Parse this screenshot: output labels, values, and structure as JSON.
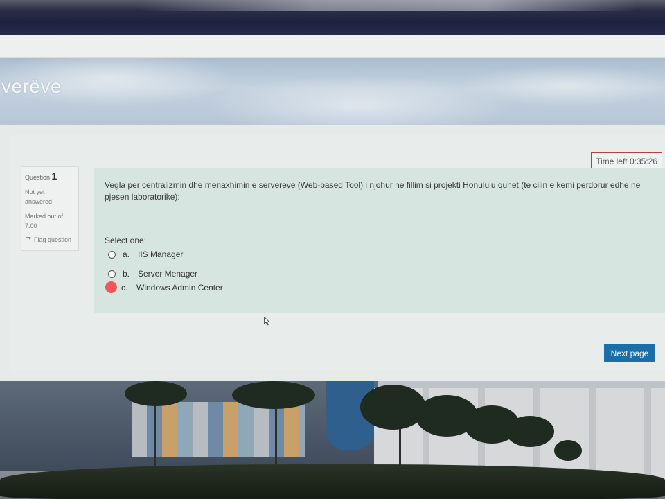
{
  "page": {
    "title_fragment": "verëve"
  },
  "quiz": {
    "timer_label": "Time left 0:35:26",
    "question": {
      "label": "Question",
      "number": "1",
      "status_line1": "Not yet",
      "status_line2": "answered",
      "marked_line1": "Marked out of",
      "marked_line2": "7.00",
      "flag_label": "Flag question",
      "text": "Vegla per centralizmin dhe menaxhimin e servereve (Web-based Tool) i njohur ne fillim si projekti Honululu quhet (te cilin e kemi perdorur edhe ne pjesen laboratorike):",
      "prompt": "Select one:",
      "options": [
        {
          "letter": "a.",
          "label": "IIS Manager",
          "selected": false
        },
        {
          "letter": "b.",
          "label": "Server Menager",
          "selected": false
        },
        {
          "letter": "c.",
          "label": "Windows Admin Center",
          "selected": true
        }
      ]
    },
    "next_button": "Next page"
  },
  "colors": {
    "accent": "#1b6fa8",
    "timer_border": "#b34343",
    "selected_option": "#f0585e",
    "question_background": "#d7e5e1"
  },
  "icons": [
    "flag-icon",
    "mouse-cursor-icon"
  ]
}
